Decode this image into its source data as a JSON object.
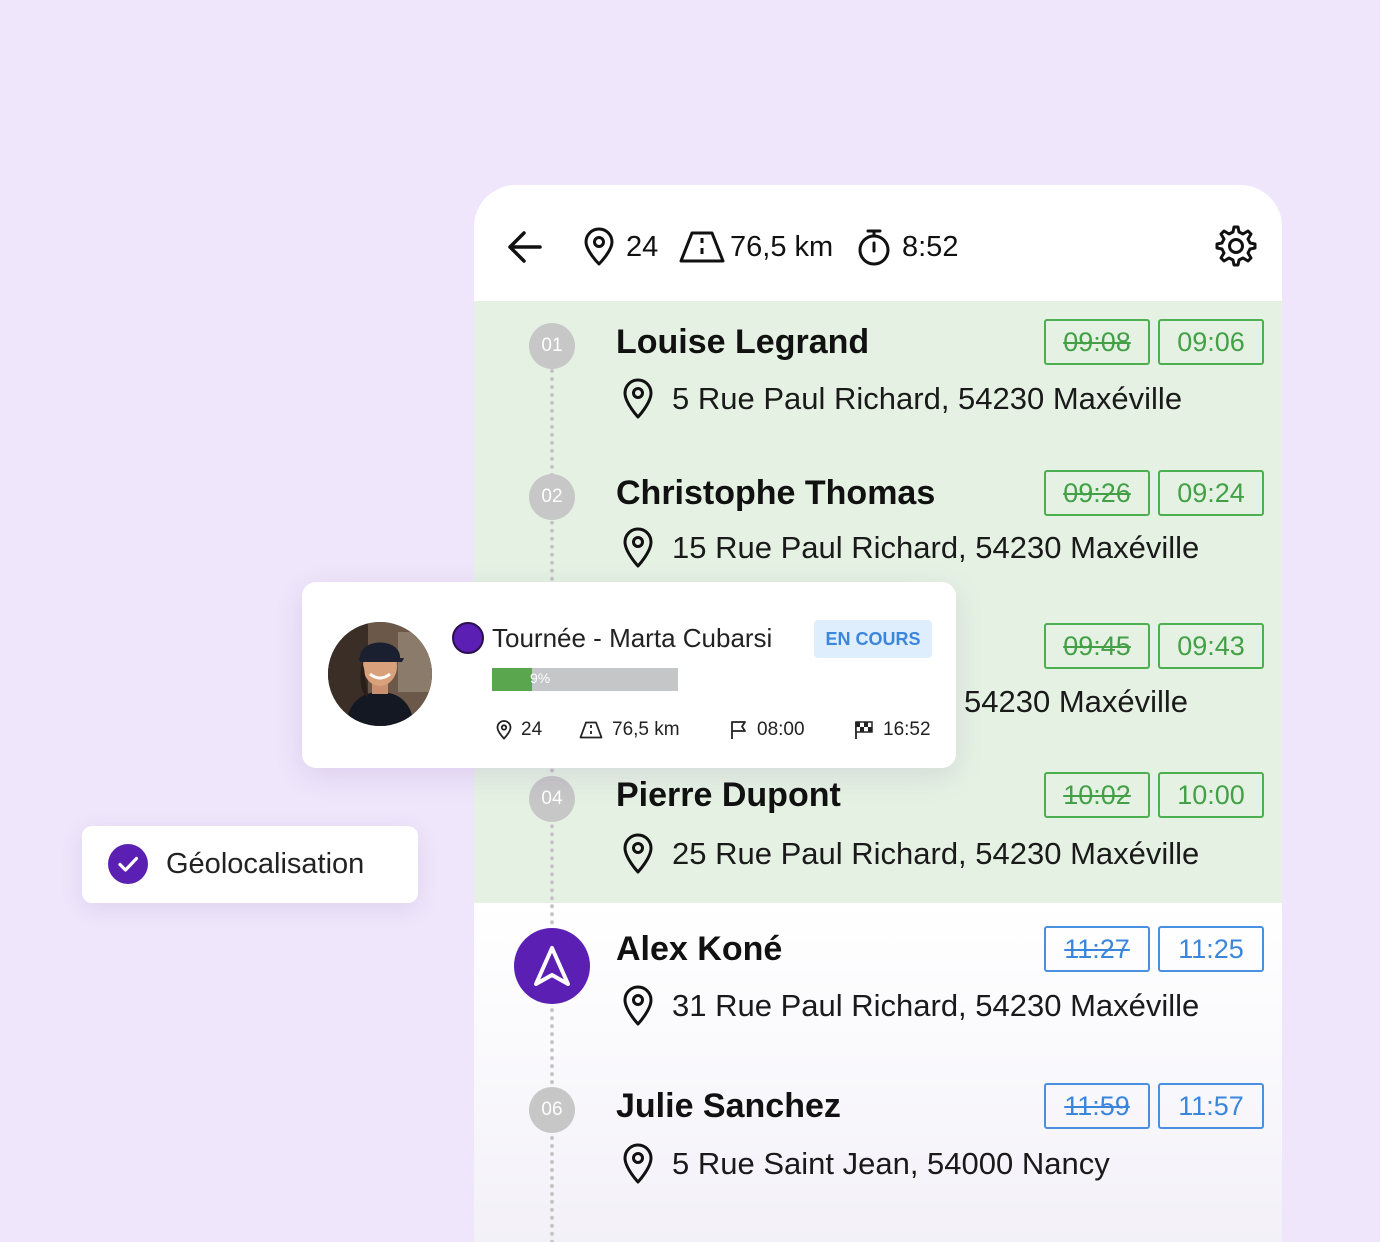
{
  "header": {
    "stops": "24",
    "distance": "76,5 km",
    "duration": "8:52"
  },
  "stops": [
    {
      "num": "01",
      "name": "Louise Legrand",
      "address": "5 Rue Paul Richard, 54230 Maxéville",
      "planned": "09:08",
      "actual": "09:06"
    },
    {
      "num": "02",
      "name": "Christophe Thomas",
      "address": "15 Rue Paul Richard, 54230 Maxéville",
      "planned": "09:26",
      "actual": "09:24"
    },
    {
      "address_partial": "54230 Maxéville",
      "planned": "09:45",
      "actual": "09:43"
    },
    {
      "num": "04",
      "name": "Pierre Dupont",
      "address": "25 Rue Paul Richard, 54230 Maxéville",
      "planned": "10:02",
      "actual": "10:00"
    },
    {
      "name": "Alex Koné",
      "address": "31 Rue Paul Richard, 54230 Maxéville",
      "planned": "11:27",
      "actual": "11:25"
    },
    {
      "num": "06",
      "name": "Julie Sanchez",
      "address": "5 Rue Saint Jean, 54000 Nancy",
      "planned": "11:59",
      "actual": "11:57"
    }
  ],
  "tour_card": {
    "title": "Tournée - Marta Cubarsi",
    "status": "EN COURS",
    "progress_pct": 9,
    "progress_label": "9%",
    "stops": "24",
    "distance": "76,5 km",
    "start": "08:00",
    "end": "16:52"
  },
  "geo_chip": {
    "label": "Géolocalisation"
  },
  "colors": {
    "background": "#efe6fb",
    "accent": "#5b1fb3",
    "done_zone": "#e5f2e3",
    "done_time": "#43a047",
    "upcoming_time": "#3b86dd"
  }
}
